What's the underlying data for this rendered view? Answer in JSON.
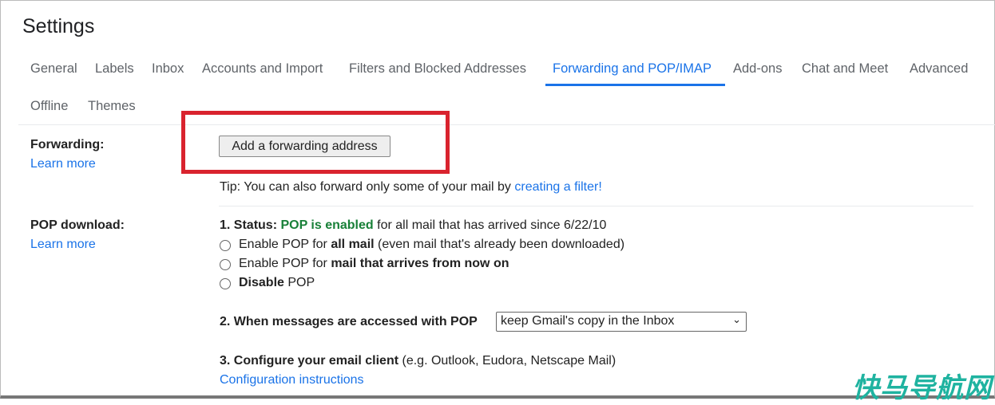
{
  "title": "Settings",
  "tabs": [
    "General",
    "Labels",
    "Inbox",
    "Accounts and Import",
    "Filters and Blocked Addresses",
    "Forwarding and POP/IMAP",
    "Add-ons",
    "Chat and Meet",
    "Advanced",
    "Offline",
    "Themes"
  ],
  "active_tab": "Forwarding and POP/IMAP",
  "forwarding": {
    "label": "Forwarding:",
    "learn_more": "Learn more",
    "button": "Add a forwarding address",
    "tip": "Tip: You can also forward only some of your mail by ",
    "tip_link": "creating a filter!"
  },
  "pop": {
    "label": "POP download:",
    "learn_more": "Learn more",
    "status_prefix": "1. Status: ",
    "status_value": "POP is enabled",
    "status_suffix": " for all mail that has arrived since 6/22/10",
    "opt1_a": "Enable POP for ",
    "opt1_b": "all mail",
    "opt1_c": " (even mail that's already been downloaded)",
    "opt2_a": "Enable POP for ",
    "opt2_b": "mail that arrives from now on",
    "opt3_a": "Disable",
    "opt3_b": " POP",
    "access_label": "2. When messages are accessed with POP",
    "access_value": "keep Gmail's copy in the Inbox",
    "configure_label": "3. Configure your email client",
    "configure_suffix": " (e.g. Outlook, Eudora, Netscape Mail)",
    "config_link": "Configuration instructions"
  },
  "watermark": "快马导航网",
  "colors": {
    "accent": "#1a73e8",
    "highlight_box": "#d9232e",
    "status_green": "#188038"
  }
}
